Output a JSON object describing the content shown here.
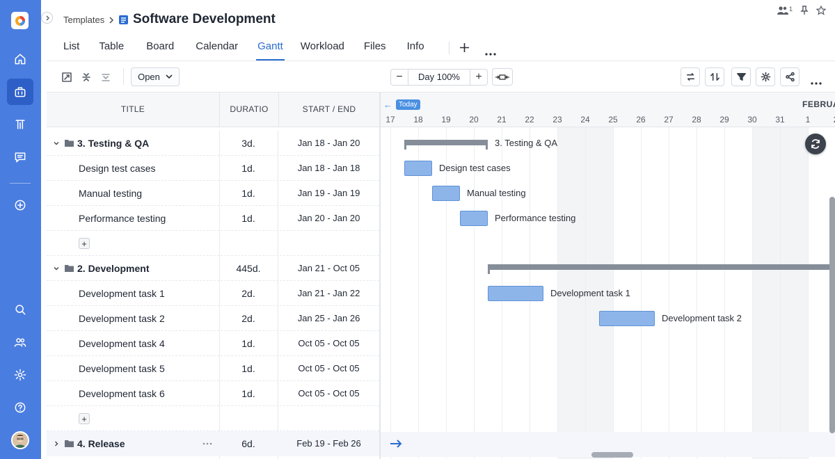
{
  "breadcrumb": {
    "parent": "Templates"
  },
  "page": {
    "title": "Software Development"
  },
  "header": {
    "members_count": "1"
  },
  "tabs": [
    {
      "label": "List"
    },
    {
      "label": "Table"
    },
    {
      "label": "Board"
    },
    {
      "label": "Calendar"
    },
    {
      "label": "Gantt",
      "active": true
    },
    {
      "label": "Workload"
    },
    {
      "label": "Files"
    },
    {
      "label": "Info"
    }
  ],
  "toolbar": {
    "filter_select": "Open",
    "zoom_label": "Day 100%"
  },
  "grid": {
    "columns": {
      "title": "TITLE",
      "duration": "DURATIO",
      "dates": "START / END"
    },
    "rows": [
      {
        "type": "group",
        "title": "3. Testing & QA",
        "duration": "3d.",
        "dates": "Jan 18 - Jan 20"
      },
      {
        "type": "task",
        "title": "Design test cases",
        "duration": "1d.",
        "dates": "Jan 18 - Jan 18"
      },
      {
        "type": "task",
        "title": "Manual testing",
        "duration": "1d.",
        "dates": "Jan 19 - Jan 19"
      },
      {
        "type": "task",
        "title": "Performance testing",
        "duration": "1d.",
        "dates": "Jan 20 - Jan 20"
      },
      {
        "type": "add"
      },
      {
        "type": "group",
        "title": "2. Development",
        "duration": "445d.",
        "dates": "Jan 21 - Oct 05"
      },
      {
        "type": "task",
        "title": "Development task 1",
        "duration": "2d.",
        "dates": "Jan 21 - Jan 22"
      },
      {
        "type": "task",
        "title": "Development task 2",
        "duration": "2d.",
        "dates": "Jan 25 - Jan 26"
      },
      {
        "type": "task",
        "title": "Development task 4",
        "duration": "1d.",
        "dates": "Oct 05 - Oct 05"
      },
      {
        "type": "task",
        "title": "Development task 5",
        "duration": "1d.",
        "dates": "Oct 05 - Oct 05"
      },
      {
        "type": "task",
        "title": "Development task 6",
        "duration": "1d.",
        "dates": "Oct 05 - Oct 05"
      },
      {
        "type": "add"
      },
      {
        "type": "group",
        "title": "4. Release",
        "duration": "6d.",
        "dates": "Feb 19 - Feb 26",
        "collapsed": true
      }
    ]
  },
  "gantt": {
    "today_label": "Today",
    "month_label": "FEBRUARY",
    "days": [
      "17",
      "18",
      "19",
      "20",
      "21",
      "22",
      "23",
      "24",
      "25",
      "26",
      "27",
      "28",
      "29",
      "30",
      "31",
      "1",
      "2"
    ],
    "weekend_days": [
      "23",
      "24",
      "30",
      "31"
    ],
    "bars": [
      {
        "label": "3. Testing & QA",
        "kind": "summary",
        "start": "18",
        "end": "20"
      },
      {
        "label": "Design test cases",
        "kind": "task",
        "start": "18",
        "end": "18"
      },
      {
        "label": "Manual testing",
        "kind": "task",
        "start": "19",
        "end": "19"
      },
      {
        "label": "Performance testing",
        "kind": "task",
        "start": "20",
        "end": "20"
      },
      {
        "label": "Development task 1",
        "kind": "task",
        "start": "21",
        "end": "22"
      },
      {
        "label": "Development task 2",
        "kind": "task",
        "start": "25",
        "end": "26"
      }
    ]
  },
  "colors": {
    "sidebar": "#4a7de0",
    "accent": "#2b6cd0",
    "task_bar": "#8db5ea",
    "summary_bar": "#858d99"
  }
}
